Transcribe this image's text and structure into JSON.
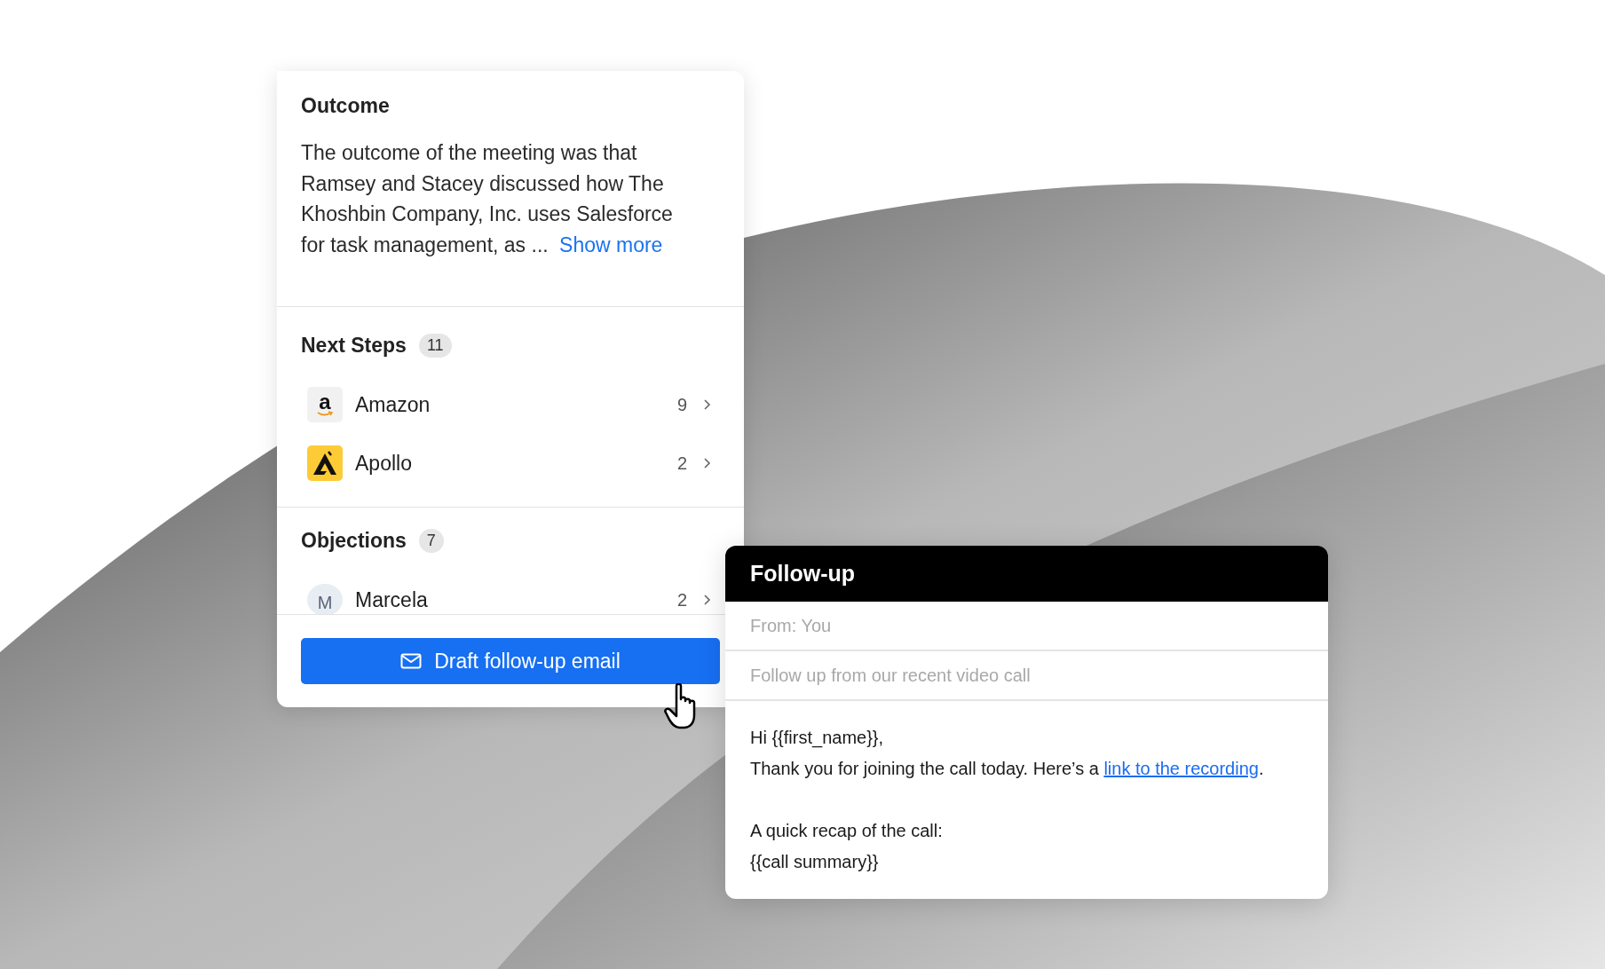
{
  "summary_card": {
    "outcome": {
      "title": "Outcome",
      "text": "The outcome of the meeting was that Ramsey and Stacey discussed how The Khoshbin Company, Inc. uses Salesforce for task management, as ...",
      "link": "Show more"
    },
    "sections": [
      {
        "title": "Next Steps",
        "count": "11",
        "items": [
          {
            "kind": "amazon",
            "logo": "a",
            "name": "Amazon",
            "count": "9"
          },
          {
            "kind": "apollo",
            "name": "Apollo",
            "count": "2"
          }
        ]
      },
      {
        "title": "Objections",
        "count": "7",
        "items": [
          {
            "kind": "avatar",
            "initial": "M",
            "name": "Marcela",
            "count": "2"
          }
        ]
      }
    ],
    "button": "Draft follow-up email"
  },
  "email_card": {
    "title": "Follow-up",
    "from": "From: You",
    "subject": "Follow up from our recent video call",
    "body": [
      {
        "lines": [
          {
            "text": "Hi {{first_name}},"
          },
          {
            "text": "Thank you for joining the call today. Here’s a ",
            "link": "link to the recording",
            "after": "."
          }
        ]
      },
      {
        "lines": [
          {
            "text": "A quick recap of the call:"
          },
          {
            "text": "{{call summary}}"
          }
        ]
      }
    ]
  }
}
